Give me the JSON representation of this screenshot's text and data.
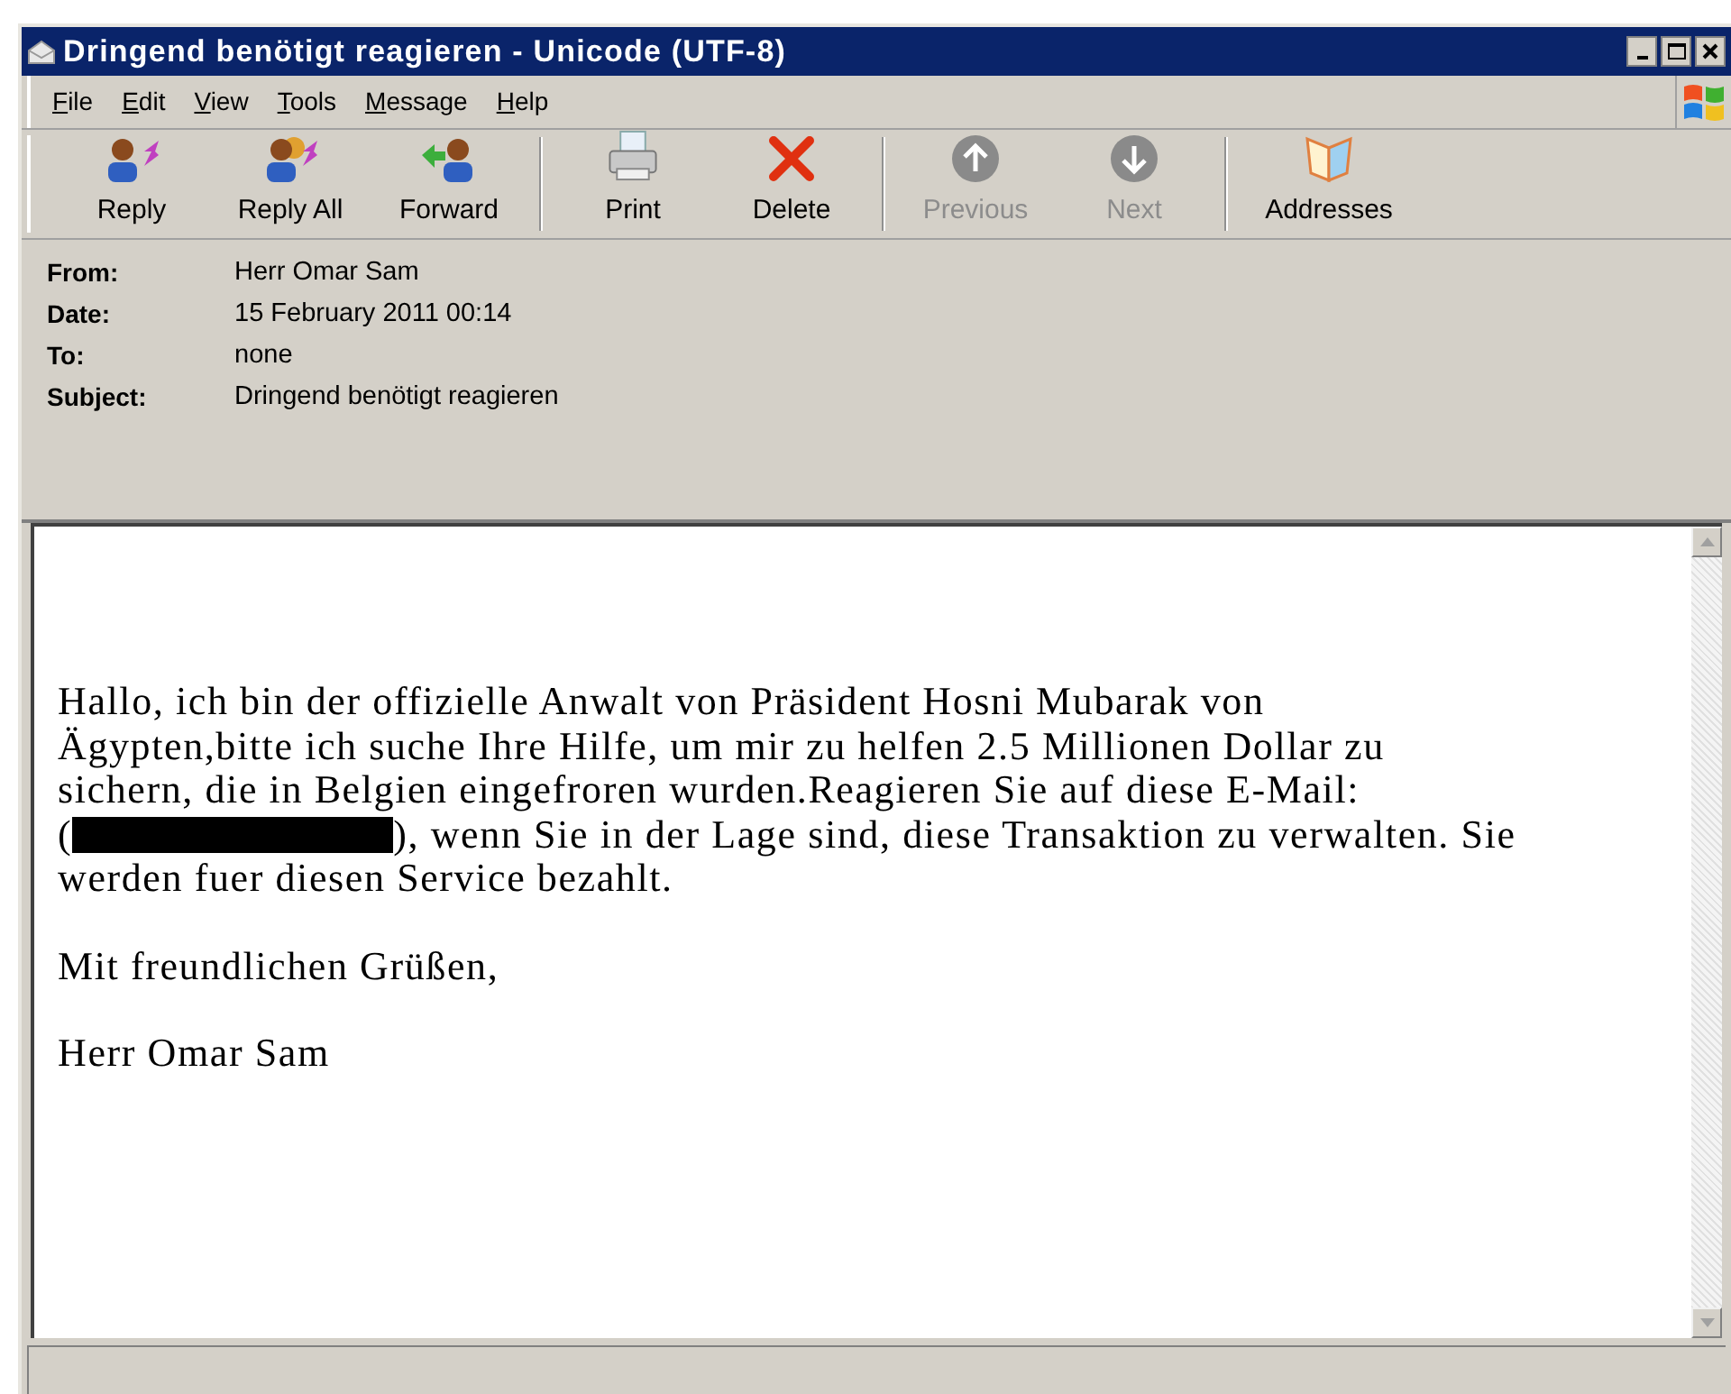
{
  "window": {
    "title": "Dringend benötigt reagieren - Unicode (UTF-8)"
  },
  "menu": [
    {
      "label": "File"
    },
    {
      "label": "Edit"
    },
    {
      "label": "View"
    },
    {
      "label": "Tools"
    },
    {
      "label": "Message"
    },
    {
      "label": "Help"
    }
  ],
  "toolbar": [
    {
      "kind": "reply",
      "label": "Reply",
      "disabled": false
    },
    {
      "kind": "reply_all",
      "label": "Reply All",
      "disabled": false
    },
    {
      "kind": "forward",
      "label": "Forward",
      "disabled": false
    },
    {
      "kind": "print",
      "label": "Print",
      "disabled": false
    },
    {
      "kind": "delete",
      "label": "Delete",
      "disabled": false
    },
    {
      "kind": "previous",
      "label": "Previous",
      "disabled": true
    },
    {
      "kind": "next",
      "label": "Next",
      "disabled": true
    },
    {
      "kind": "addresses",
      "label": "Addresses",
      "disabled": false
    }
  ],
  "header": [
    {
      "label": "From:",
      "value": "Herr Omar Sam"
    },
    {
      "label": "Date:",
      "value": "15 February 2011 00:14"
    },
    {
      "label": "To:",
      "value": "none"
    },
    {
      "label": "Subject:",
      "value": "Dringend benötigt reagieren"
    }
  ],
  "body": [
    {
      "lines": [
        {
          "text": "Hallo, ich bin der offizielle Anwalt von Präsident Hosni Mubarak von"
        },
        {
          "text": "Ägypten,bitte ich suche Ihre Hilfe, um mir zu helfen 2.5 Millionen Dollar zu"
        },
        {
          "text": "sichern, die in Belgien eingefroren wurden.Reagieren Sie auf diese E-Mail:"
        },
        {
          "kind": "redacted",
          "before": "(",
          "after": "), wenn Sie in der Lage sind, diese Transaktion zu verwalten. Sie"
        },
        {
          "text": "werden fuer diesen Service bezahlt."
        }
      ]
    },
    {
      "lines": [
        {
          "text": "Mit freundlichen Grüßen,"
        }
      ]
    },
    {
      "lines": [
        {
          "text": "Herr Omar Sam"
        }
      ]
    }
  ]
}
